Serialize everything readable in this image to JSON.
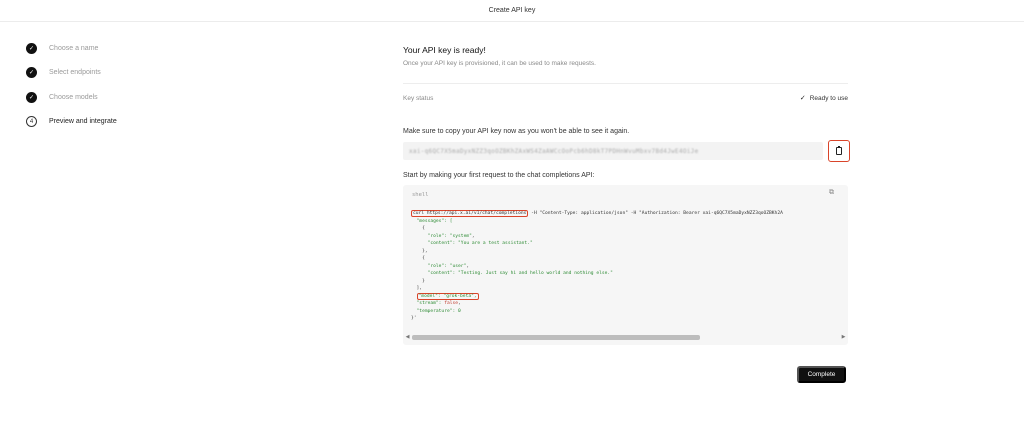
{
  "header": {
    "title": "Create API key"
  },
  "steps": [
    {
      "label": "Choose a name",
      "done": true
    },
    {
      "label": "Select endpoints",
      "done": true
    },
    {
      "label": "Choose models",
      "done": true
    },
    {
      "label": "Preview and integrate",
      "number": "4",
      "active": true
    }
  ],
  "main": {
    "title": "Your API key is ready!",
    "subtitle": "Once your API key is provisioned, it can be used to make requests.",
    "status_label": "Key status",
    "status_value": "Ready to use",
    "copy_note": "Make sure to copy your API key now as you won't be able to see it again.",
    "api_key_masked": "xai-q6QC7X5maDyxNZZ3qoOZBKhZAxWS4ZaAWCcOoPcb6hD8kT7PDHnWvuMbxv7Bd4JwE4OiJe",
    "start_note": "Start by making your first request to the chat completions API:",
    "code_lang": "shell",
    "complete_label": "Complete"
  },
  "code": {
    "l1_url": "curl https://api.x.ai/v1/chat/completions",
    "l1_rest": " -H \"Content-Type: application/json\" -H \"Authorization: Bearer xai-q6QC7X5maDyxNZZ3qoOZBKh2A",
    "l2": "  \"messages\": [",
    "l3": "    {",
    "l4_k": "      \"role\": ",
    "l4_v": "\"system\"",
    "l4_e": ",",
    "l5_k": "      \"content\": ",
    "l5_v": "\"You are a test assistant.\"",
    "l6": "    },",
    "l7": "    {",
    "l8_k": "      \"role\": ",
    "l8_v": "\"user\"",
    "l8_e": ",",
    "l9_k": "      \"content\": ",
    "l9_v": "\"Testing. Just say hi and hello world and nothing else.\"",
    "l10": "    }",
    "l11": "  ],",
    "l12_hl": "\"model\": \"grok-beta\",",
    "l13_k": "  \"stream\": ",
    "l13_v": "false",
    "l13_e": ",",
    "l14": "  \"temperature\": 0",
    "l15": "}'"
  },
  "colors": {
    "highlight": "#d9442a",
    "string": "#2c8a33",
    "button": "#111111"
  },
  "icons": {
    "step_done": "check-circle-icon",
    "copy": "clipboard-icon",
    "status": "check-icon"
  }
}
